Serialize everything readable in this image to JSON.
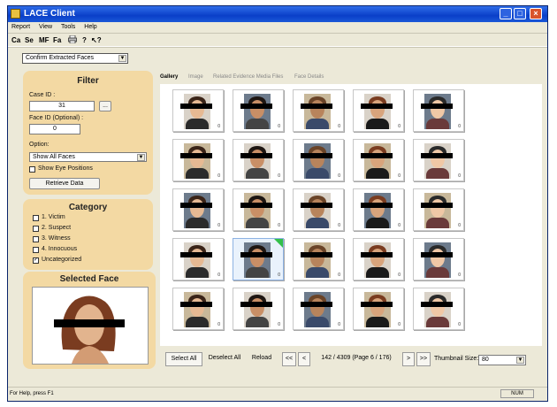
{
  "window": {
    "title": "LACE Client"
  },
  "menu": [
    "Report",
    "View",
    "Tools",
    "Help"
  ],
  "toolbar": {
    "items": [
      "Ca",
      "Se",
      "MF",
      "Fa"
    ],
    "print_icon": "printer-icon",
    "help_icon": "help-icon",
    "whatsthis_icon": "whats-this-icon"
  },
  "mode_select": {
    "value": "Confirm Extracted Faces"
  },
  "filter": {
    "title": "Filter",
    "case_id_label": "Case ID :",
    "case_id_value": "31",
    "browse_label": "...",
    "face_id_label": "Face ID (Optional) :",
    "face_id_value": "0",
    "option_label": "Option:",
    "option_value": "Show All Faces",
    "show_eye_label": "Show Eye Positions",
    "retrieve_label": "Retrieve Data"
  },
  "category": {
    "title": "Category",
    "items": [
      {
        "label": "1. Victim",
        "checked": false
      },
      {
        "label": "2. Suspect",
        "checked": false
      },
      {
        "label": "3. Witness",
        "checked": false
      },
      {
        "label": "4. Innocuous",
        "checked": false
      },
      {
        "label": "Uncategorized",
        "checked": true
      }
    ]
  },
  "selected_face": {
    "title": "Selected Face"
  },
  "tabs": [
    "Gallery",
    "Image",
    "Related Evidence Media Files",
    "Face Details"
  ],
  "gallery": {
    "thumbnail_label": "0",
    "selected_index": 16
  },
  "bottom": {
    "select_all": "Select All",
    "deselect_all": "Deselect All",
    "reload": "Reload",
    "first": "<<",
    "prev": "<",
    "page_info": "142 / 4309 (Page 6 / 176)",
    "next": ">",
    "last": ">>",
    "thumb_size_label": "Thumbnail Size:",
    "thumb_size_value": "80"
  },
  "status": {
    "message": "For Help, press F1",
    "indicator": "NUM"
  },
  "colors": {
    "panel": "#f3d9a3",
    "title_bar": "#0a3fc8",
    "selected_corner": "#33c04a"
  }
}
